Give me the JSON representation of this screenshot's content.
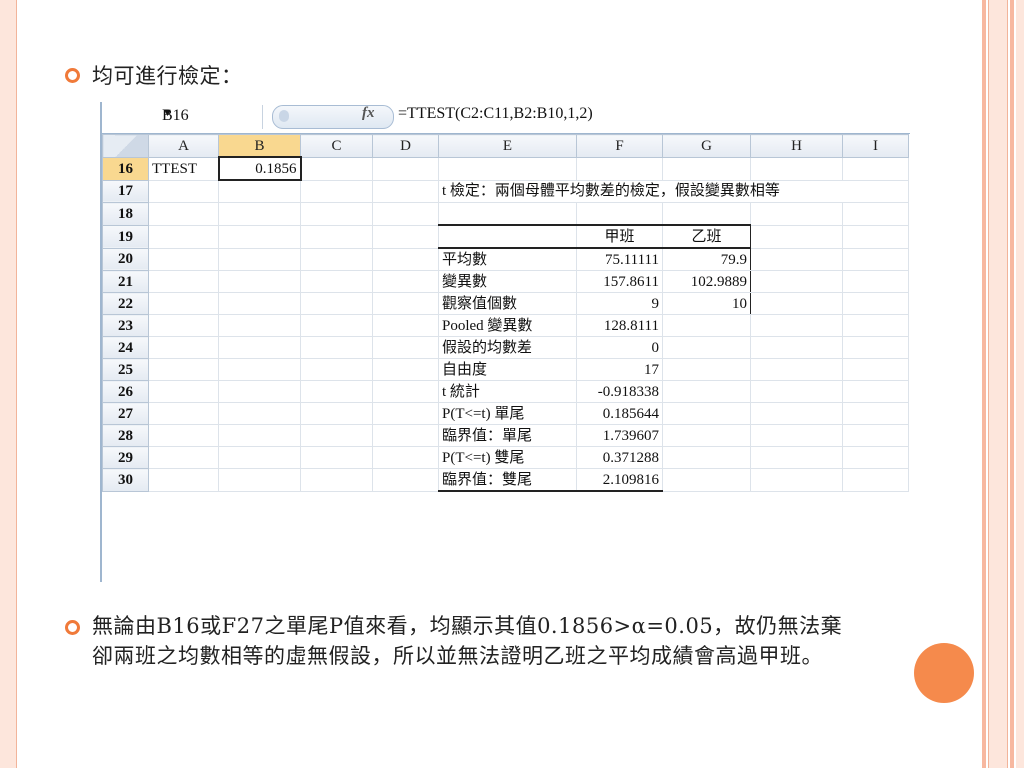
{
  "bullets": [
    {
      "text": "均可進行檢定："
    },
    {
      "line1": "無論由B16或F27之單尾P值來看，均顯示其值0.1856>α=0.05，故仍無法棄",
      "line2": "卻兩班之均數相等的虛無假設，所以並無法證明乙班之平均成績會高過甲班。"
    }
  ],
  "spreadsheet": {
    "name_box": "B16",
    "fx_label": "fx",
    "formula": "=TTEST(C2:C11,B2:B10,1,2)",
    "columns": [
      "A",
      "B",
      "C",
      "D",
      "E",
      "F",
      "G",
      "H",
      "I"
    ],
    "rows": [
      {
        "num": "16",
        "A": "TTEST",
        "B": "0.1856",
        "E": "",
        "F": "",
        "G": ""
      },
      {
        "num": "17",
        "E": "t 檢定：兩個母體平均數差的檢定，假設變異數相等"
      },
      {
        "num": "18"
      },
      {
        "num": "19",
        "E": "",
        "F": "甲班",
        "G": "乙班"
      },
      {
        "num": "20",
        "E": "平均數",
        "F": "75.11111",
        "G": "79.9"
      },
      {
        "num": "21",
        "E": "變異數",
        "F": "157.8611",
        "G": "102.9889"
      },
      {
        "num": "22",
        "E": "觀察值個數",
        "F": "9",
        "G": "10"
      },
      {
        "num": "23",
        "E": "Pooled 變異數",
        "F": "128.8111"
      },
      {
        "num": "24",
        "E": "假設的均數差",
        "F": "0"
      },
      {
        "num": "25",
        "E": "自由度",
        "F": "17"
      },
      {
        "num": "26",
        "E": "t 統計",
        "F": "-0.918338"
      },
      {
        "num": "27",
        "E": "P(T<=t) 單尾",
        "F": "0.185644"
      },
      {
        "num": "28",
        "E": "臨界值：單尾",
        "F": "1.739607"
      },
      {
        "num": "29",
        "E": "P(T<=t) 雙尾",
        "F": "0.371288"
      },
      {
        "num": "30",
        "E": "臨界值：雙尾",
        "F": "2.109816"
      }
    ]
  },
  "colors": {
    "accent": "#f07a3a",
    "dot": "#f58a4c",
    "selected_header": "#f9d890"
  }
}
